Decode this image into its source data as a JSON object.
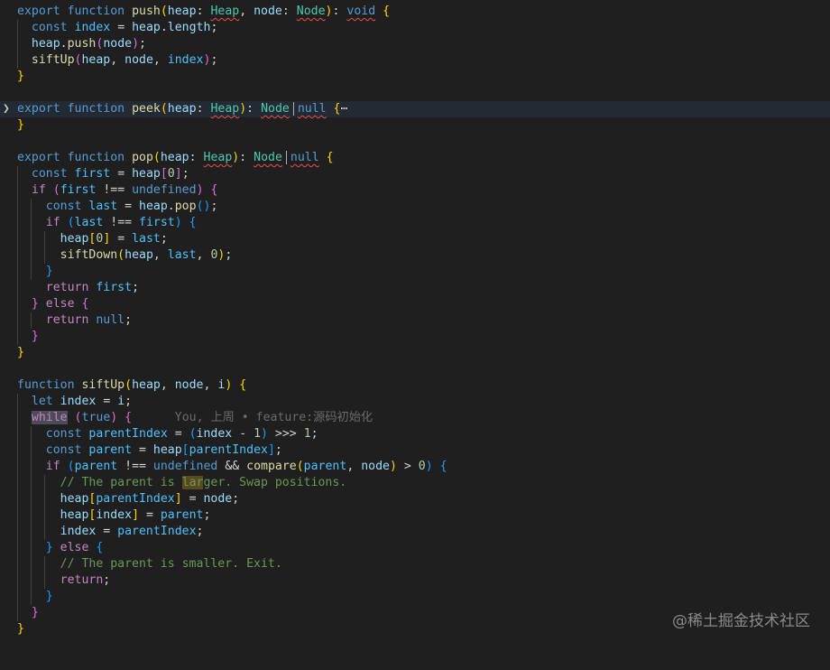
{
  "editor": {
    "lines": [
      "export function push(heap: Heap, node: Node): void {",
      "  const index = heap.length;",
      "  heap.push(node);",
      "  siftUp(heap, node, index);",
      "}",
      "",
      "export function peek(heap: Heap): Node | null {⋯",
      "}",
      "",
      "export function pop(heap: Heap): Node | null {",
      "  const first = heap[0];",
      "  if (first !== undefined) {",
      "    const last = heap.pop();",
      "    if (last !== first) {",
      "      heap[0] = last;",
      "      siftDown(heap, last, 0);",
      "    }",
      "    return first;",
      "  } else {",
      "    return null;",
      "  }",
      "}",
      "",
      "function siftUp(heap, node, i) {",
      "  let index = i;",
      "  while (true) {",
      "    const parentIndex = (index - 1) >>> 1;",
      "    const parent = heap[parentIndex];",
      "    if (parent !== undefined && compare(parent, node) > 0) {",
      "      // The parent is larger. Swap positions.",
      "      heap[parentIndex] = node;",
      "      heap[index] = parent;",
      "      index = parentIndex;",
      "    } else {",
      "      // The parent is smaller. Exit.",
      "      return;",
      "    }",
      "  }",
      "}"
    ],
    "blame": "You, 上周 • feature:源码初始化",
    "fold_icon": "chevron-right-icon"
  },
  "watermark": "@稀土掘金技术社区",
  "colors": {
    "background": "#1f1f1f",
    "keyword": "#569cd6",
    "control": "#c586c0",
    "function": "#dcdcaa",
    "variable": "#9cdcfe",
    "type": "#4ec9b0",
    "number": "#b5cea8",
    "comment": "#6a9955"
  }
}
